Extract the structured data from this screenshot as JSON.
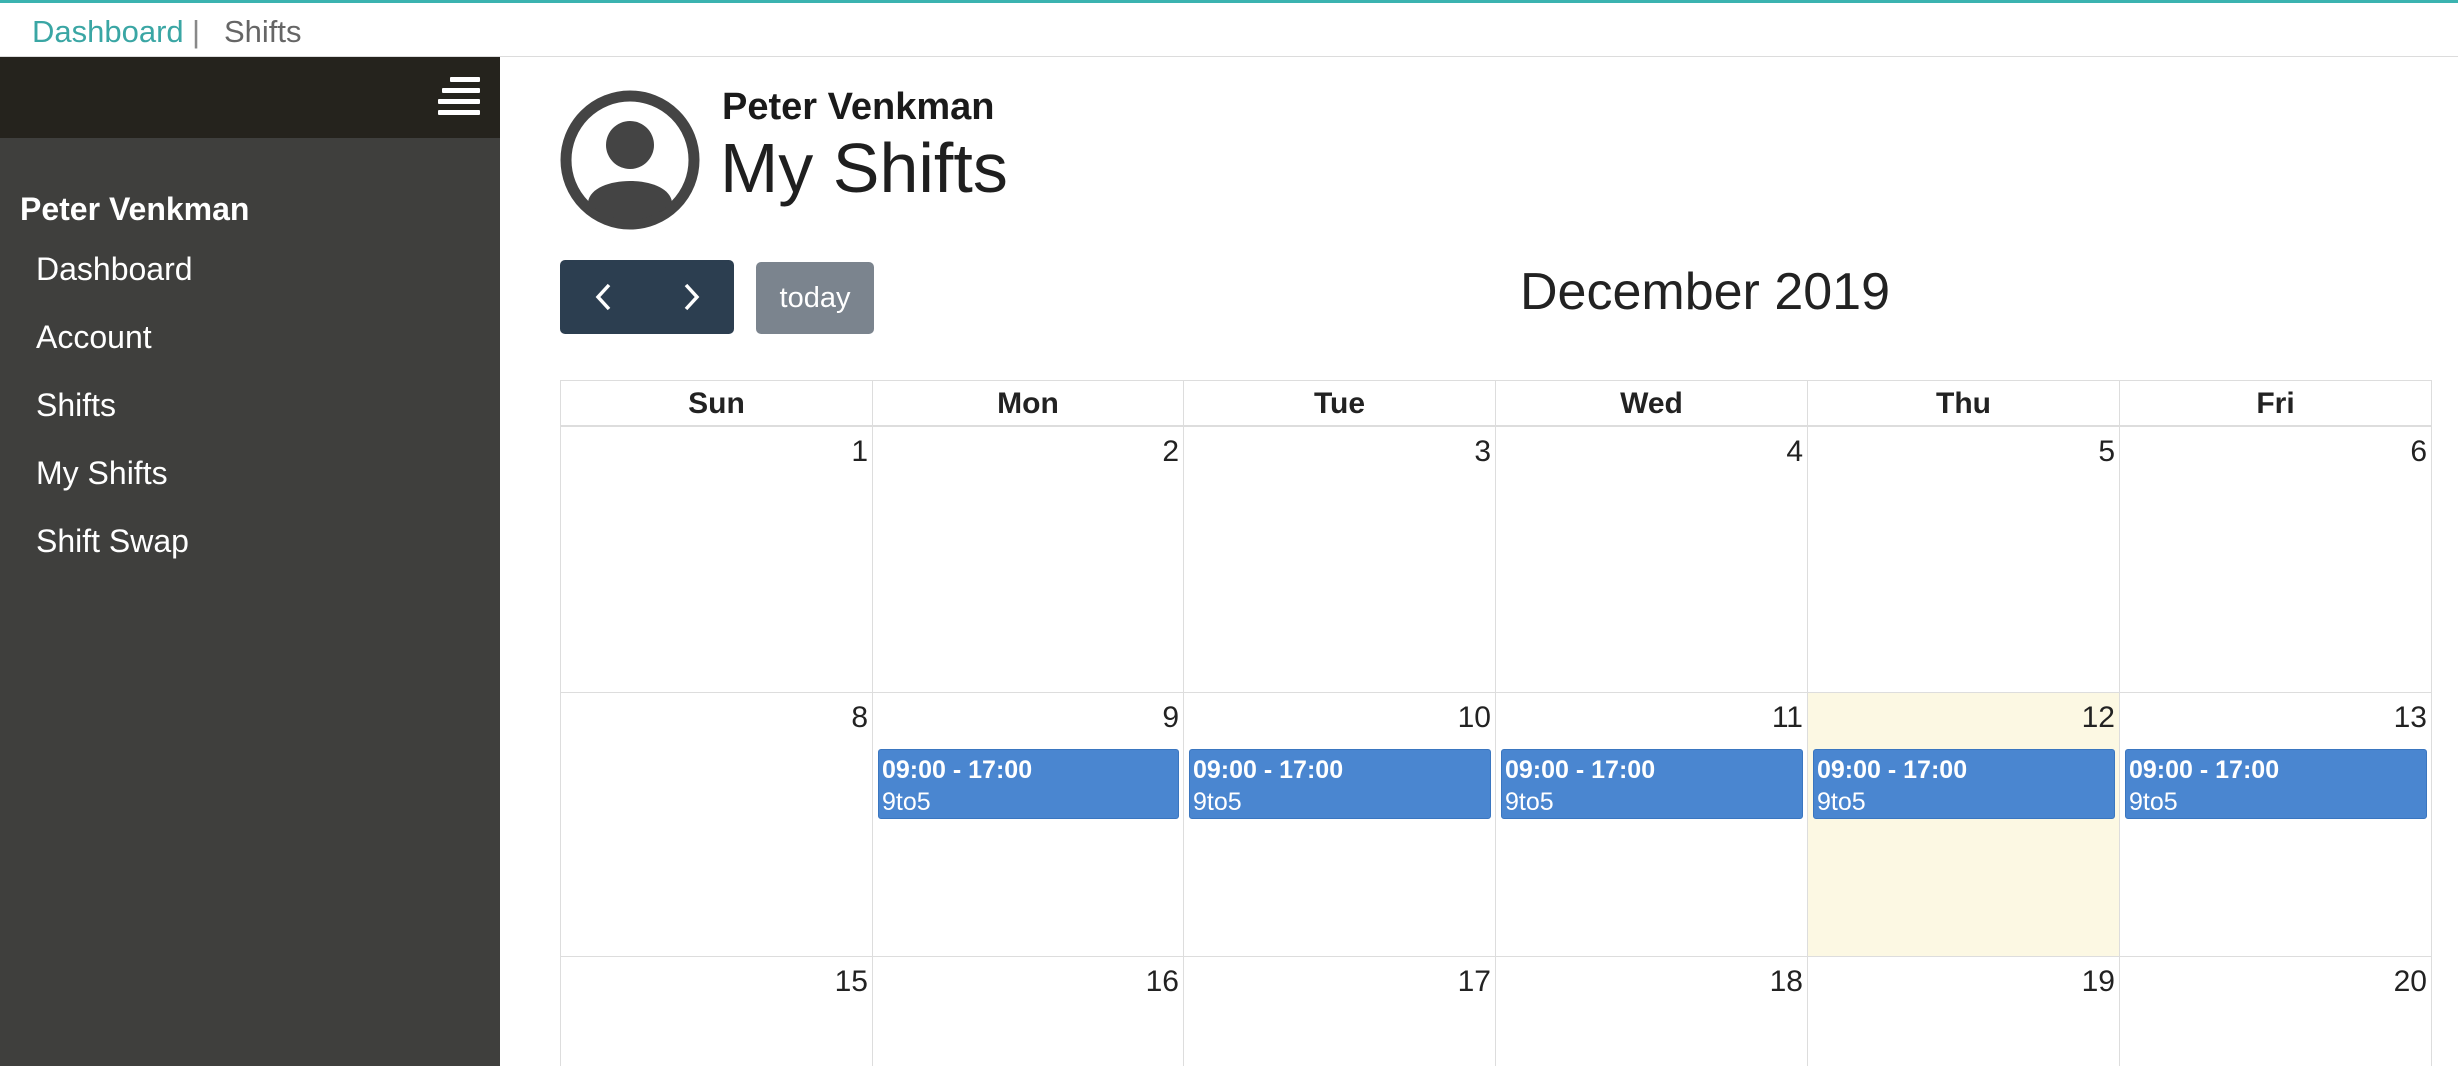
{
  "breadcrumb": {
    "link": "Dashboard",
    "separator": "|",
    "current": "Shifts"
  },
  "sidebar": {
    "user": "Peter Venkman",
    "items": [
      {
        "label": "Dashboard"
      },
      {
        "label": "Account"
      },
      {
        "label": "Shifts"
      },
      {
        "label": "My Shifts"
      },
      {
        "label": "Shift Swap"
      }
    ]
  },
  "header": {
    "user": "Peter Venkman",
    "title": "My Shifts"
  },
  "toolbar": {
    "prev": "previous",
    "next": "next",
    "today_label": "today",
    "month_title": "December 2019"
  },
  "calendar": {
    "days": [
      "Sun",
      "Mon",
      "Tue",
      "Wed",
      "Thu",
      "Fri"
    ],
    "weeks": [
      [
        {
          "day": "1",
          "event": null
        },
        {
          "day": "2",
          "event": null
        },
        {
          "day": "3",
          "event": null
        },
        {
          "day": "4",
          "event": null
        },
        {
          "day": "5",
          "event": null
        },
        {
          "day": "6",
          "event": null
        }
      ],
      [
        {
          "day": "8",
          "event": null
        },
        {
          "day": "9",
          "event": {
            "time": "09:00 - 17:00",
            "title": "9to5"
          }
        },
        {
          "day": "10",
          "event": {
            "time": "09:00 - 17:00",
            "title": "9to5"
          }
        },
        {
          "day": "11",
          "event": {
            "time": "09:00 - 17:00",
            "title": "9to5"
          }
        },
        {
          "day": "12",
          "today": true,
          "event": {
            "time": "09:00 - 17:00",
            "title": "9to5"
          }
        },
        {
          "day": "13",
          "event": {
            "time": "09:00 - 17:00",
            "title": "9to5"
          }
        }
      ],
      [
        {
          "day": "15",
          "event": null
        },
        {
          "day": "16",
          "event": null
        },
        {
          "day": "17",
          "event": null
        },
        {
          "day": "18",
          "event": null
        },
        {
          "day": "19",
          "event": null
        },
        {
          "day": "20",
          "event": null
        }
      ]
    ]
  },
  "colors": {
    "accent": "#3aa6a4",
    "event": "#4a86d0",
    "today_bg": "#fcf8e3",
    "sidebar": "#3f3f3d"
  }
}
